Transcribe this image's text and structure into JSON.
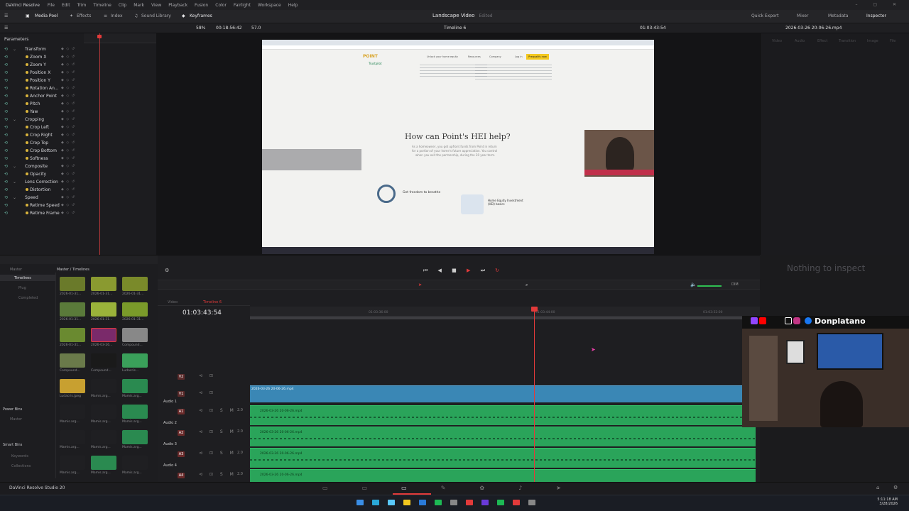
{
  "app": {
    "name": "DaVinci Resolve",
    "version_label": "DaVinci Resolve Studio 20"
  },
  "menu": [
    "File",
    "Edit",
    "Trim",
    "Timeline",
    "Clip",
    "Mark",
    "View",
    "Playback",
    "Fusion",
    "Color",
    "Fairlight",
    "Workspace",
    "Help"
  ],
  "toolbar": {
    "left": [
      "Media Pool",
      "Effects",
      "Index",
      "Sound Library",
      "Keyframes"
    ],
    "project_title": "Landscape Video",
    "project_status": "Edited",
    "right": [
      "Quick Export",
      "Mixer",
      "Metadata",
      "Inspector"
    ]
  },
  "viewer_bar": {
    "zoom": "58%",
    "source_tc": "00:18:56:42",
    "speed": "57.0",
    "timeline_name": "Timeline 6",
    "record_tc": "01:03:43:54",
    "clip_name": "2026-03-26 20-06-26.mp4"
  },
  "parameters": {
    "header": "Parameters",
    "rows": [
      {
        "label": "Transform",
        "group": true
      },
      {
        "label": "Zoom X"
      },
      {
        "label": "Zoom Y"
      },
      {
        "label": "Position X"
      },
      {
        "label": "Position Y"
      },
      {
        "label": "Rotation An..."
      },
      {
        "label": "Anchor Point"
      },
      {
        "label": "Pitch"
      },
      {
        "label": "Yaw"
      },
      {
        "label": "Cropping",
        "group": true
      },
      {
        "label": "Crop Left"
      },
      {
        "label": "Crop Right"
      },
      {
        "label": "Crop Top"
      },
      {
        "label": "Crop Bottom"
      },
      {
        "label": "Softness"
      },
      {
        "label": "Composite",
        "group": true
      },
      {
        "label": "Opacity"
      },
      {
        "label": "Lens Correction",
        "group": true
      },
      {
        "label": "Distortion"
      },
      {
        "label": "Speed",
        "group": true
      },
      {
        "label": "Retime Speed"
      },
      {
        "label": "Retime Frame"
      }
    ]
  },
  "webpage": {
    "brand": "POINT",
    "nav": [
      "Unlock your home equity",
      "Resources",
      "Company",
      "Log in"
    ],
    "cta": "Prequalify now",
    "trust": "Trustpilot",
    "heading": "How can Point's HEI help?",
    "sub1": "As a homeowner, you get upfront funds from Point in return",
    "sub2": "for a portion of your home's future appreciation. You control",
    "sub3": "when you exit the partnership, during the 30 year term.",
    "card1": "Get freedom to breathe",
    "card2": "Home Equity Investment (HEI) basics"
  },
  "inspector": {
    "tabs": [
      "Video",
      "Audio",
      "Effect",
      "Transition",
      "Image",
      "File"
    ],
    "empty": "Nothing to inspect"
  },
  "mediapool": {
    "top": [
      "Master",
      "Master / Timelines"
    ],
    "bins": [
      "Timelines",
      "Plug",
      "Completed"
    ],
    "sections": [
      "Power Bins",
      "Master",
      "Smart Bins",
      "Keywords",
      "Collections"
    ],
    "clips": [
      "2026-01-31...",
      "2026-01-31...",
      "2026-01-31...",
      "2026-01-31...",
      "2026-01-31...",
      "2026-01-31...",
      "2026-01-31...",
      "2026-03-26...",
      "Compound...",
      "Compound...",
      "Compound...",
      "Ludacris...",
      "Ludacris.jpeg",
      "Mamis.arg...",
      "Mamis.arg...",
      "Mamis.arg...",
      "Mamis.arg...",
      "Mamis.arg...",
      "Mamis.arg...",
      "Mamis.arg...",
      "Mamis.arg...",
      "Mamis.arg...",
      "Mamis.arg...",
      "Mamis.arg..."
    ]
  },
  "timeline": {
    "tab": "Timeline 6",
    "timecode": "01:03:43:54",
    "ruler": [
      "01:03:36:00",
      "01:03:44:00",
      "01:03:52:00"
    ],
    "tracks": [
      {
        "id": "V2",
        "name": ""
      },
      {
        "id": "V1",
        "name": ""
      },
      {
        "id": "A1",
        "name": "Audio 1",
        "level": "2.0"
      },
      {
        "id": "A2",
        "name": "Audio 2",
        "level": "2.0"
      },
      {
        "id": "A3",
        "name": "Audio 3",
        "level": "2.0"
      },
      {
        "id": "A4",
        "name": "Audio 4",
        "level": "2.0"
      }
    ],
    "video_clip": "2026-03-26 20-06-26.mp4",
    "audio_clip": "2026-03-26 20-06-26.mp4",
    "dim_label": "DIM"
  },
  "overlay": {
    "handle": "Donplatano"
  },
  "taskbar": {
    "time": "5:11:18 AM",
    "date": "3/28/2026"
  },
  "colors": {
    "accent_red": "#e23a3a",
    "audio_green": "#2aa45a",
    "video_blue": "#3a87b5"
  }
}
